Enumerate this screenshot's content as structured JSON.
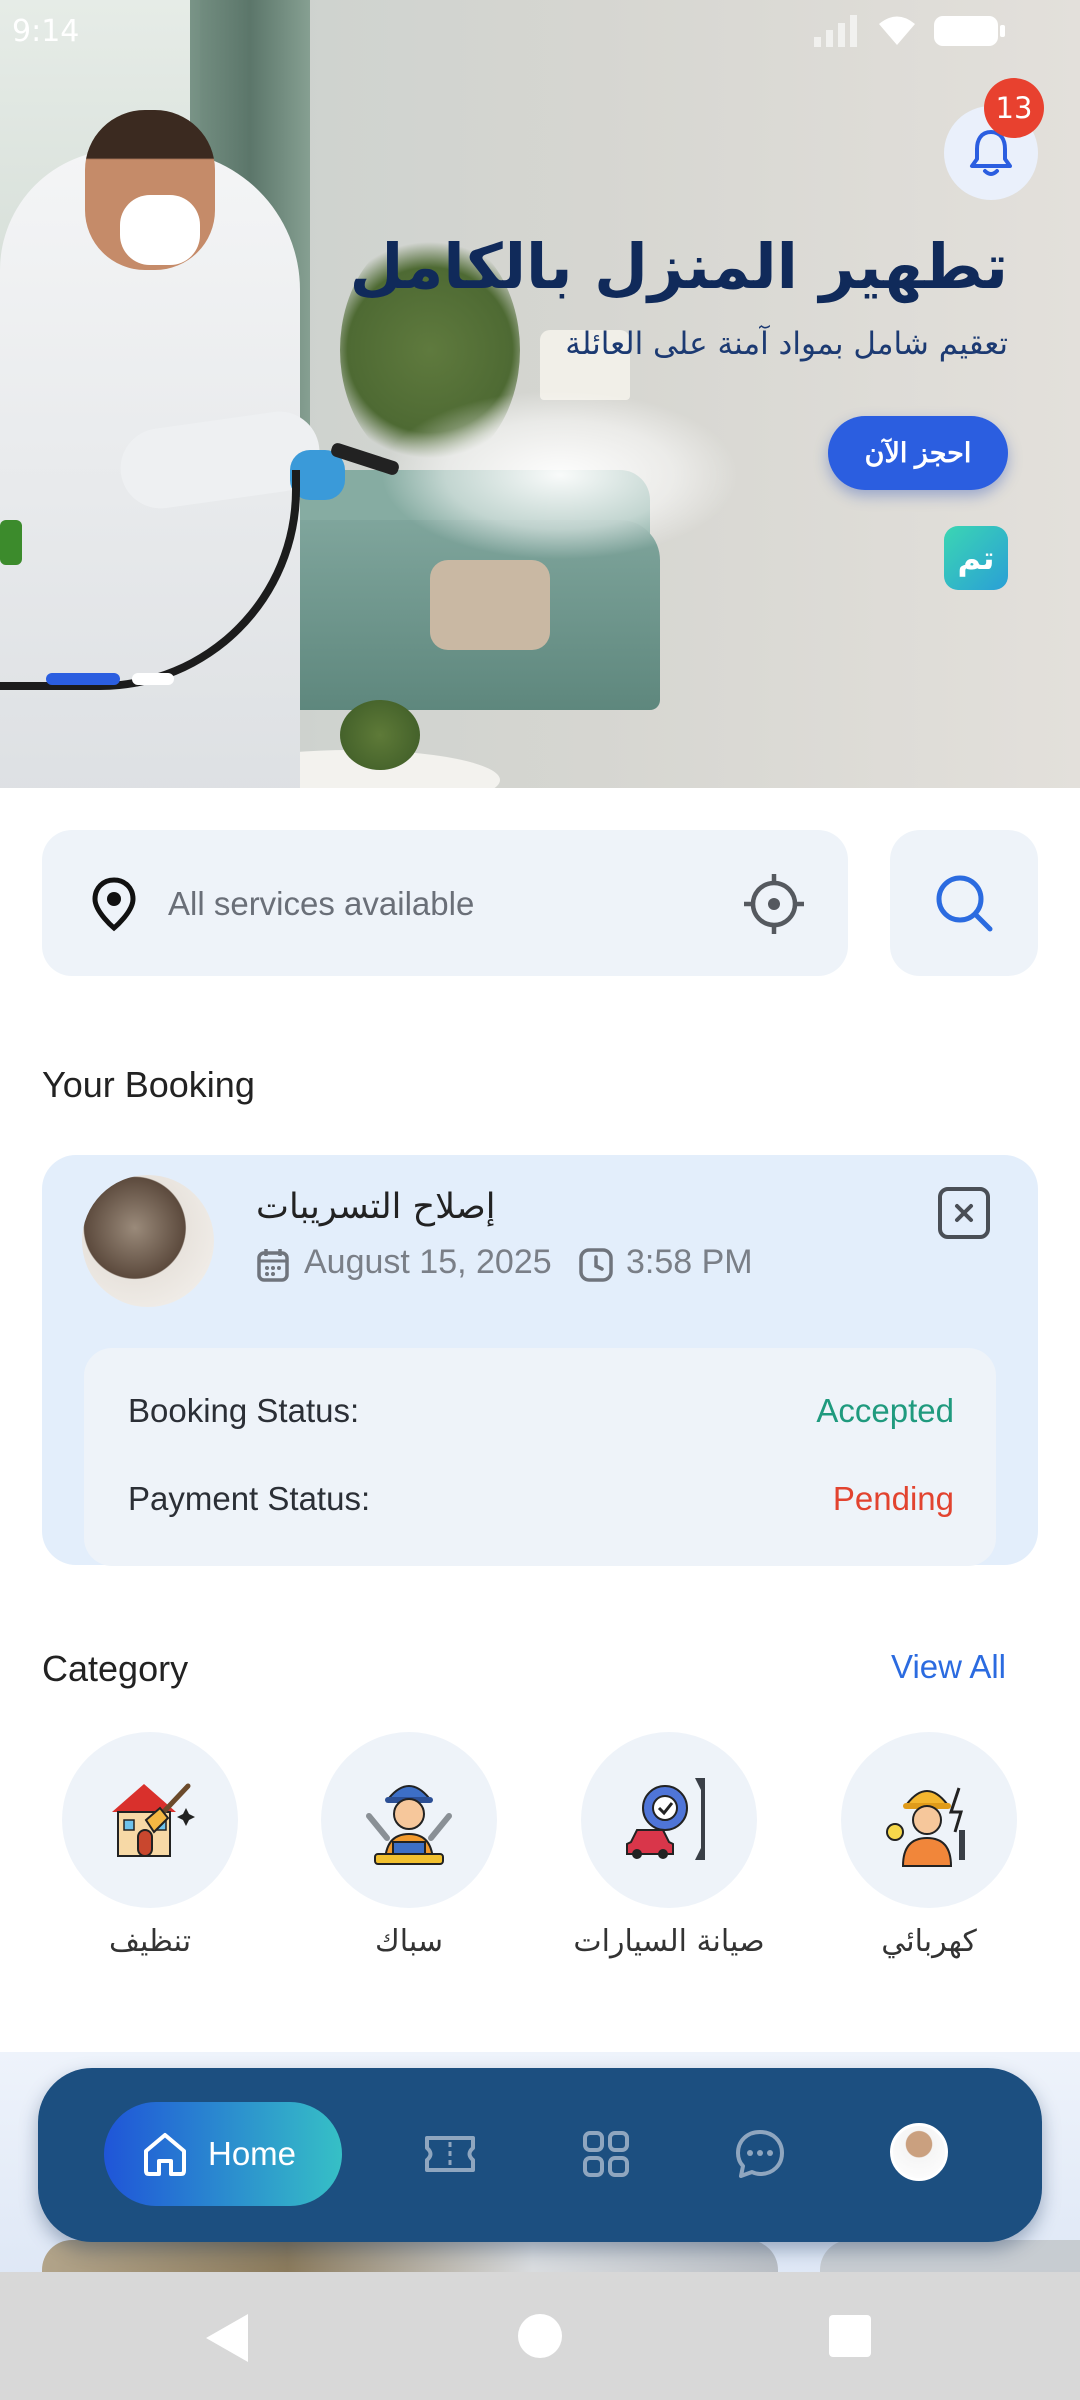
{
  "status_bar": {
    "time": "9:14"
  },
  "hero": {
    "title": "تطهير المنزل بالكامل",
    "subtitle": "تعقيم شامل بمواد آمنة على العائلة",
    "cta_label": "احجز الآن",
    "brand_logo_text": "تم",
    "notification_count": "13",
    "slides_total": 2,
    "slide_active": 1,
    "icons": [
      "bell-icon"
    ]
  },
  "search": {
    "placeholder": "All services available",
    "icons": [
      "location-pin-icon",
      "locate-crosshair-icon",
      "search-icon"
    ]
  },
  "booking": {
    "section_title": "Your Booking",
    "service_name": "إصلاح التسريبات",
    "date": "August 15, 2025",
    "time": "3:58 PM",
    "booking_status_label": "Booking Status:",
    "booking_status_value": "Accepted",
    "payment_status_label": "Payment Status:",
    "payment_status_value": "Pending",
    "colors": {
      "accepted": "#1f9a7e",
      "pending": "#e2432f"
    },
    "icons": [
      "calendar-icon",
      "clock-icon",
      "close-icon"
    ]
  },
  "category": {
    "section_title": "Category",
    "view_all_label": "View All",
    "items": [
      {
        "label": "تنظيف",
        "icon": "house-cleaning-icon"
      },
      {
        "label": "سباك",
        "icon": "plumber-icon"
      },
      {
        "label": "صيانة السيارات",
        "icon": "car-service-icon"
      },
      {
        "label": "كهربائي",
        "icon": "electrician-icon"
      }
    ]
  },
  "bottom_nav": {
    "home_label": "Home",
    "items": [
      "home-icon",
      "ticket-icon",
      "grid-icon",
      "chat-icon",
      "profile-avatar"
    ]
  },
  "theme": {
    "accent": "#2b5ee0",
    "nav_bg": "#1c4f80",
    "card_bg": "#e3eefb",
    "field_bg": "#eef3f9"
  }
}
